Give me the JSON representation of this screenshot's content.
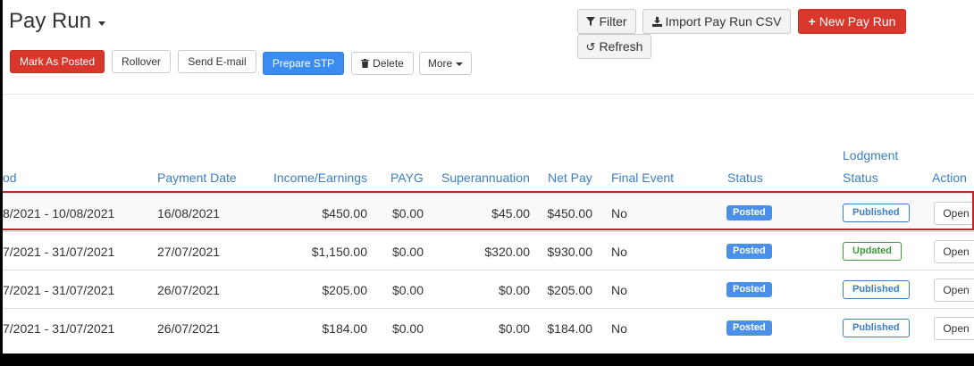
{
  "page_title": "Pay Run",
  "toolbar": {
    "mark_posted": "Mark As Posted",
    "rollover": "Rollover",
    "send_email": "Send E-mail",
    "prepare_stp": "Prepare STP",
    "delete": "Delete",
    "more": "More"
  },
  "top_actions": {
    "filter": "Filter",
    "import_csv": "Import Pay Run CSV",
    "new_pay_run": "New Pay Run",
    "refresh": "Refresh"
  },
  "table": {
    "headers": {
      "period": "od",
      "payment_date": "Payment Date",
      "income": "Income/Earnings",
      "payg": "PAYG",
      "super": "Superannuation",
      "net_pay": "Net Pay",
      "final_event": "Final Event",
      "status": "Status",
      "lodgment_line1": "Lodgment",
      "lodgment_line2": "Status",
      "action": "Action"
    },
    "rows": [
      {
        "period": "8/2021 - 10/08/2021",
        "payment_date": "16/08/2021",
        "income": "$450.00",
        "payg": "$0.00",
        "super": "$45.00",
        "net_pay": "$450.00",
        "final_event": "No",
        "status": "Posted",
        "lodgment": "Published",
        "action": "Open"
      },
      {
        "period": "7/2021 - 31/07/2021",
        "payment_date": "27/07/2021",
        "income": "$1,150.00",
        "payg": "$0.00",
        "super": "$320.00",
        "net_pay": "$930.00",
        "final_event": "No",
        "status": "Posted",
        "lodgment": "Updated",
        "action": "Open"
      },
      {
        "period": "7/2021 - 31/07/2021",
        "payment_date": "26/07/2021",
        "income": "$205.00",
        "payg": "$0.00",
        "super": "$0.00",
        "net_pay": "$205.00",
        "final_event": "No",
        "status": "Posted",
        "lodgment": "Published",
        "action": "Open"
      },
      {
        "period": "7/2021 - 31/07/2021",
        "payment_date": "26/07/2021",
        "income": "$184.00",
        "payg": "$0.00",
        "super": "$0.00",
        "net_pay": "$184.00",
        "final_event": "No",
        "status": "Posted",
        "lodgment": "Published",
        "action": "Open"
      }
    ]
  },
  "colors": {
    "accent_red": "#d9372c",
    "accent_blue": "#3b8cf0",
    "header_text": "#3a7fc2",
    "published": "#3a7fc2",
    "updated": "#3c9a3c",
    "highlight_border": "#b8272d"
  },
  "icons": {
    "filter": "filter-icon",
    "import": "download-icon",
    "new": "plus-icon",
    "refresh": "refresh-icon",
    "delete": "trash-icon"
  }
}
